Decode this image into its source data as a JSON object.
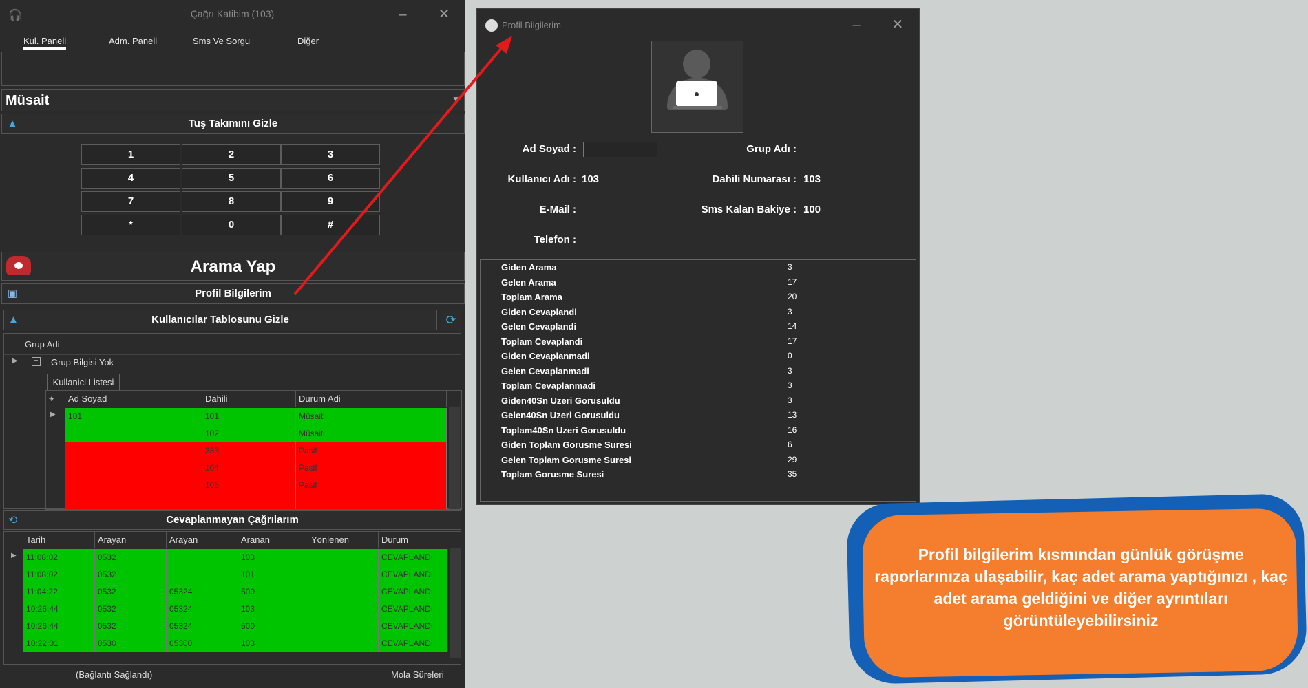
{
  "app": {
    "title": "Çağrı Katibim (103)",
    "menu": [
      "Kul. Paneli",
      "Adm. Paneli",
      "Sms Ve Sorgu",
      "Diğer"
    ],
    "status": "Müsait",
    "keypad_toggle": "Tuş Takımını Gizle",
    "keys": [
      "1",
      "2",
      "3",
      "4",
      "5",
      "6",
      "7",
      "8",
      "9",
      "*",
      "0",
      "#"
    ],
    "call_button": "Arama Yap",
    "profile_button": "Profil Bilgilerim",
    "users_toggle": "Kullanıcılar Tablosunu Gizle",
    "group_header": "Grup Adi",
    "group_row": "Grup Bilgisi Yok",
    "inner_tab": "Kullanici Listesi",
    "user_columns": [
      "Ad Soyad",
      "Dahili",
      "Durum Adi"
    ],
    "users": [
      {
        "name": "101",
        "ext": "101",
        "status": "Müsait",
        "color": "#00c400"
      },
      {
        "name": "",
        "ext": "102",
        "status": "Müsait",
        "color": "#00c400"
      },
      {
        "name": "",
        "ext": "333",
        "status": "Pasif",
        "color": "#ff0000"
      },
      {
        "name": "",
        "ext": "104",
        "status": "Pasif",
        "color": "#ff0000"
      },
      {
        "name": "",
        "ext": "105",
        "status": "Pasif",
        "color": "#ff0000"
      }
    ],
    "missed_title": "Cevaplanmayan Çağrılarım",
    "missed_columns": [
      "Tarih",
      "Arayan",
      "Arayan",
      "Aranan",
      "Yönlenen",
      "Durum"
    ],
    "missed_calls": [
      {
        "time": "11:08:02",
        "caller": "0532",
        "caller2": "",
        "called": "103",
        "status": "CEVAPLANDI"
      },
      {
        "time": "11:08:02",
        "caller": "0532",
        "caller2": "",
        "called": "101",
        "status": "CEVAPLANDI"
      },
      {
        "time": "11:04:22",
        "caller": "0532",
        "caller2": "05324",
        "called": "500",
        "status": "CEVAPLANDI"
      },
      {
        "time": "10:26:44",
        "caller": "0532",
        "caller2": "05324",
        "called": "103",
        "status": "CEVAPLANDI"
      },
      {
        "time": "10:26:44",
        "caller": "0532",
        "caller2": "05324",
        "called": "500",
        "status": "CEVAPLANDI"
      },
      {
        "time": "10:22:01",
        "caller": "0530",
        "caller2": "05300",
        "called": "103",
        "status": "CEVAPLANDI"
      }
    ],
    "footer_connection": "(Bağlantı Sağlandı)",
    "footer_break": "Mola Süreleri"
  },
  "profile": {
    "title": "Profil Bilgilerim",
    "fields": {
      "name_label": "Ad Soyad :",
      "group_label": "Grup Adı :",
      "username_label": "Kullanıcı Adı :",
      "username_value": "103",
      "ext_label": "Dahili Numarası :",
      "ext_value": "103",
      "email_label": "E-Mail :",
      "sms_label": "Sms Kalan Bakiye :",
      "sms_value": "100",
      "phone_label": "Telefon :"
    },
    "stats": [
      {
        "name": "Giden Arama",
        "value": "3"
      },
      {
        "name": "Gelen Arama",
        "value": "17"
      },
      {
        "name": "Toplam Arama",
        "value": "20"
      },
      {
        "name": "Giden Cevaplandi",
        "value": "3"
      },
      {
        "name": "Gelen Cevaplandi",
        "value": "14"
      },
      {
        "name": "Toplam Cevaplandi",
        "value": "17"
      },
      {
        "name": "Giden Cevaplanmadi",
        "value": "0"
      },
      {
        "name": "Gelen Cevaplanmadi",
        "value": "3"
      },
      {
        "name": "Toplam Cevaplanmadi",
        "value": "3"
      },
      {
        "name": "Giden40Sn Uzeri Gorusuldu",
        "value": "3"
      },
      {
        "name": "Gelen40Sn Uzeri Gorusuldu",
        "value": "13"
      },
      {
        "name": "Toplam40Sn Uzeri Gorusuldu",
        "value": "16"
      },
      {
        "name": "Giden Toplam Gorusme Suresi",
        "value": "6"
      },
      {
        "name": "Gelen Toplam Gorusme Suresi",
        "value": "29"
      },
      {
        "name": "Toplam Gorusme Suresi",
        "value": "35"
      }
    ]
  },
  "callout": "Profil bilgilerim kısmından günlük görüşme raporlarınıza ulaşabilir, kaç adet arama yaptığınızı , kaç adet arama geldiğini ve diğer ayrıntıları görüntüleyebilirsiniz",
  "colors": {
    "background": "#cdd1d0",
    "window": "#2b2b2b",
    "available": "#00c400",
    "passive": "#ff0000",
    "arrow": "#e11b1b",
    "callout_fill": "#f47e2d",
    "callout_border": "#1560b7"
  }
}
